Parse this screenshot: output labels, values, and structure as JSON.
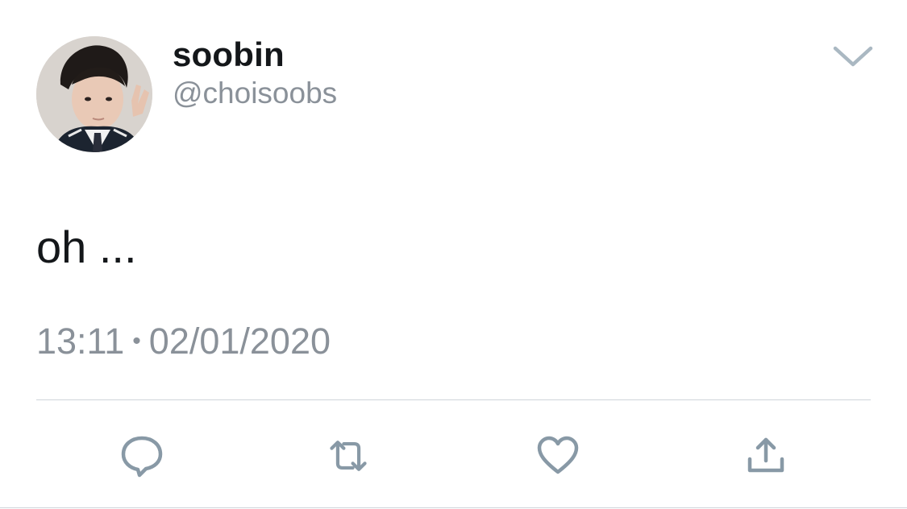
{
  "tweet": {
    "display_name": "soobin",
    "handle": "@choisoobs",
    "text": "oh ...",
    "time": "13:11",
    "separator": "•",
    "date": "02/01/2020"
  },
  "icons": {
    "more": "chevron-down-icon",
    "reply": "reply-bubble-icon",
    "retweet": "retweet-icon",
    "like": "heart-icon",
    "share": "share-icon"
  },
  "colors": {
    "text_primary": "#14171a",
    "text_secondary": "#8a9199",
    "icon": "#8899a6",
    "divider": "#cfd5da"
  }
}
